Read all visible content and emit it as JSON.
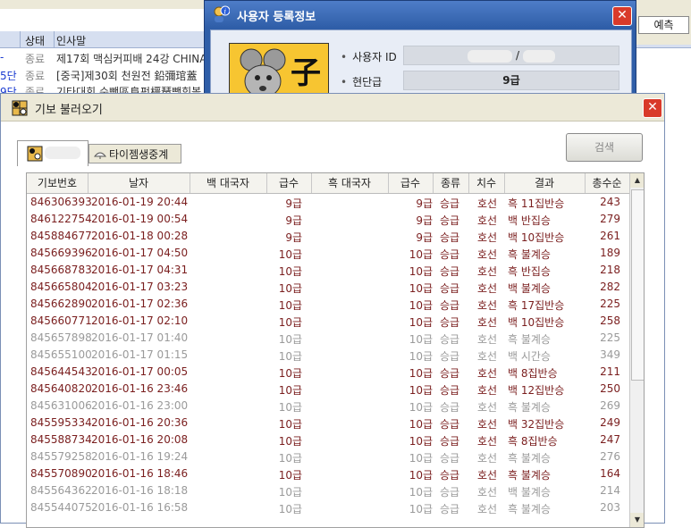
{
  "background_window": {
    "top_strip_text": "",
    "columns": [
      "상태",
      "인사말"
    ],
    "rows": [
      {
        "rank": "-",
        "status": "종료",
        "greeting": "제17회 맥심커피배 24강 CHINA"
      },
      {
        "rank": "5단",
        "status": "종료",
        "greeting": "[중국]제30회 천원전 鉛彌琯蓋"
      },
      {
        "rank": "9단",
        "status": "종료",
        "greeting": "기타대회 순뺀區阜펀橿琶뺏힝볼"
      }
    ],
    "right_tab_label": "예측"
  },
  "user_info_dialog": {
    "title": "사용자 등록정보",
    "close_label": "✕",
    "avatar_char": "子",
    "fields": [
      {
        "label": "사용자 ID",
        "value": "/"
      },
      {
        "label": "현단급",
        "value": "9급"
      }
    ]
  },
  "main_dialog": {
    "title": "기보 불러오기",
    "close_label": "✕",
    "tabs": [
      {
        "label": ""
      },
      {
        "label": "타이젬생중계"
      }
    ],
    "search_label": "검색",
    "table": {
      "headers": [
        "기보번호",
        "날자",
        "백 대국자",
        "급수",
        "흑 대국자",
        "급수",
        "종류",
        "치수",
        "결과",
        "총수순"
      ],
      "rows": [
        {
          "id": "846306393",
          "date": "2016-01-19 20:44",
          "white": "",
          "wrank": "9급",
          "black": "",
          "brank": "9급",
          "kind": "승급",
          "handicap": "호선",
          "result": "흑 11집반승",
          "moves": "243",
          "style": "dark"
        },
        {
          "id": "846122754",
          "date": "2016-01-19 00:54",
          "white": "",
          "wrank": "9급",
          "black": "",
          "brank": "9급",
          "kind": "승급",
          "handicap": "호선",
          "result": "백 반집승",
          "moves": "279",
          "style": "dark"
        },
        {
          "id": "845884677",
          "date": "2016-01-18 00:28",
          "white": "",
          "wrank": "9급",
          "black": "",
          "brank": "9급",
          "kind": "승급",
          "handicap": "호선",
          "result": "백 10집반승",
          "moves": "261",
          "style": "dark"
        },
        {
          "id": "845669396",
          "date": "2016-01-17 04:50",
          "white": "",
          "wrank": "10급",
          "black": "",
          "brank": "10급",
          "kind": "승급",
          "handicap": "호선",
          "result": "흑 불계승",
          "moves": "189",
          "style": "dark"
        },
        {
          "id": "845668783",
          "date": "2016-01-17 04:31",
          "white": "",
          "wrank": "10급",
          "black": "",
          "brank": "10급",
          "kind": "승급",
          "handicap": "호선",
          "result": "흑 반집승",
          "moves": "218",
          "style": "dark"
        },
        {
          "id": "845665804",
          "date": "2016-01-17 03:23",
          "white": "",
          "wrank": "10급",
          "black": "",
          "brank": "10급",
          "kind": "승급",
          "handicap": "호선",
          "result": "백 불계승",
          "moves": "282",
          "style": "dark"
        },
        {
          "id": "845662890",
          "date": "2016-01-17 02:36",
          "white": "",
          "wrank": "10급",
          "black": "",
          "brank": "10급",
          "kind": "승급",
          "handicap": "호선",
          "result": "흑 17집반승",
          "moves": "225",
          "style": "dark"
        },
        {
          "id": "845660771",
          "date": "2016-01-17 02:10",
          "white": "",
          "wrank": "10급",
          "black": "",
          "brank": "10급",
          "kind": "승급",
          "handicap": "호선",
          "result": "백 10집반승",
          "moves": "258",
          "style": "dark"
        },
        {
          "id": "845657898",
          "date": "2016-01-17 01:40",
          "white": "",
          "wrank": "10급",
          "black": "",
          "brank": "10급",
          "kind": "승급",
          "handicap": "호선",
          "result": "흑 불계승",
          "moves": "225",
          "style": "grey"
        },
        {
          "id": "845655100",
          "date": "2016-01-17 01:15",
          "white": "",
          "wrank": "10급",
          "black": "",
          "brank": "10급",
          "kind": "승급",
          "handicap": "호선",
          "result": "백 시간승",
          "moves": "349",
          "style": "grey"
        },
        {
          "id": "845644543",
          "date": "2016-01-17 00:05",
          "white": "",
          "wrank": "10급",
          "black": "",
          "brank": "10급",
          "kind": "승급",
          "handicap": "호선",
          "result": "백 8집반승",
          "moves": "211",
          "style": "dark"
        },
        {
          "id": "845640820",
          "date": "2016-01-16 23:46",
          "white": "",
          "wrank": "10급",
          "black": "",
          "brank": "10급",
          "kind": "승급",
          "handicap": "호선",
          "result": "백 12집반승",
          "moves": "250",
          "style": "dark"
        },
        {
          "id": "845631006",
          "date": "2016-01-16 23:00",
          "white": "",
          "wrank": "10급",
          "black": "",
          "brank": "10급",
          "kind": "승급",
          "handicap": "호선",
          "result": "흑 불계승",
          "moves": "269",
          "style": "grey"
        },
        {
          "id": "845595334",
          "date": "2016-01-16 20:36",
          "white": "",
          "wrank": "10급",
          "black": "",
          "brank": "10급",
          "kind": "승급",
          "handicap": "호선",
          "result": "백 32집반승",
          "moves": "249",
          "style": "dark"
        },
        {
          "id": "845588734",
          "date": "2016-01-16 20:08",
          "white": "",
          "wrank": "10급",
          "black": "",
          "brank": "10급",
          "kind": "승급",
          "handicap": "호선",
          "result": "흑 8집반승",
          "moves": "247",
          "style": "dark"
        },
        {
          "id": "845579258",
          "date": "2016-01-16 19:24",
          "white": "",
          "wrank": "10급",
          "black": "",
          "brank": "10급",
          "kind": "승급",
          "handicap": "호선",
          "result": "흑 불계승",
          "moves": "276",
          "style": "grey"
        },
        {
          "id": "845570890",
          "date": "2016-01-16 18:46",
          "white": "",
          "wrank": "10급",
          "black": "",
          "brank": "10급",
          "kind": "승급",
          "handicap": "호선",
          "result": "흑 불계승",
          "moves": "164",
          "style": "dark"
        },
        {
          "id": "845564362",
          "date": "2016-01-16 18:18",
          "white": "",
          "wrank": "10급",
          "black": "",
          "brank": "10급",
          "kind": "승급",
          "handicap": "호선",
          "result": "백 불계승",
          "moves": "214",
          "style": "grey"
        },
        {
          "id": "845544075",
          "date": "2016-01-16 16:58",
          "white": "",
          "wrank": "10급",
          "black": "",
          "brank": "10급",
          "kind": "승급",
          "handicap": "호선",
          "result": "흑 불계승",
          "moves": "203",
          "style": "grey"
        }
      ]
    }
  },
  "colors": {
    "dark_row": "#7a1e1e",
    "grey_row": "#9a9a9a",
    "title_bar": "#2f5ea8",
    "close_button": "#d93a2a",
    "rank_blue": "#1a3bd1"
  }
}
